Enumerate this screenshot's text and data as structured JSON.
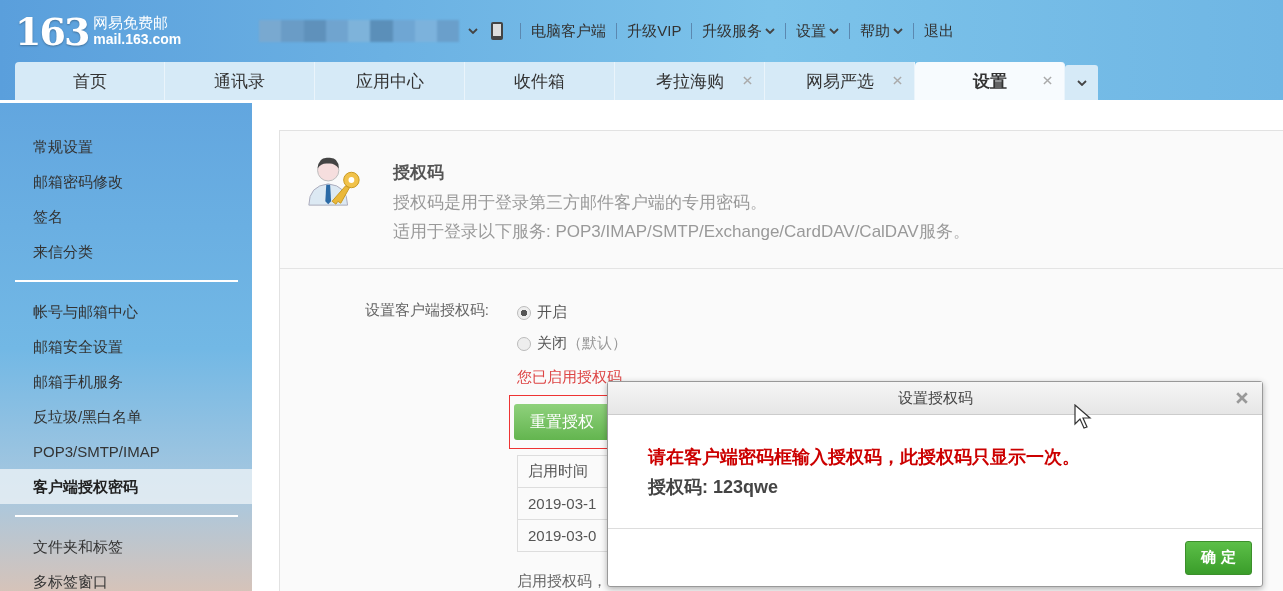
{
  "logo": {
    "number": "163",
    "name": "网易免费邮",
    "domain": "mail.163.com"
  },
  "top_links": [
    {
      "label": "电脑客户端",
      "dropdown": false
    },
    {
      "label": "升级VIP",
      "dropdown": false
    },
    {
      "label": "升级服务",
      "dropdown": true
    },
    {
      "label": "设置",
      "dropdown": true
    },
    {
      "label": "帮助",
      "dropdown": true
    },
    {
      "label": "退出",
      "dropdown": false
    }
  ],
  "tabs": [
    {
      "label": "首页",
      "closable": false,
      "selected": false
    },
    {
      "label": "通讯录",
      "closable": false,
      "selected": false
    },
    {
      "label": "应用中心",
      "closable": false,
      "selected": false
    },
    {
      "label": "收件箱",
      "closable": false,
      "selected": false
    },
    {
      "label": "考拉海购",
      "closable": true,
      "selected": false
    },
    {
      "label": "网易严选",
      "closable": true,
      "selected": false
    },
    {
      "label": "设置",
      "closable": true,
      "selected": true
    }
  ],
  "sidebar": {
    "groups": [
      {
        "items": [
          {
            "label": "常规设置",
            "selected": false
          },
          {
            "label": "邮箱密码修改",
            "selected": false
          },
          {
            "label": "签名",
            "selected": false
          },
          {
            "label": "来信分类",
            "selected": false
          }
        ]
      },
      {
        "items": [
          {
            "label": "帐号与邮箱中心",
            "selected": false
          },
          {
            "label": "邮箱安全设置",
            "selected": false
          },
          {
            "label": "邮箱手机服务",
            "selected": false
          },
          {
            "label": "反垃圾/黑白名单",
            "selected": false
          },
          {
            "label": "POP3/SMTP/IMAP",
            "selected": false
          },
          {
            "label": "客户端授权密码",
            "selected": true
          }
        ]
      },
      {
        "items": [
          {
            "label": "文件夹和标签",
            "selected": false
          },
          {
            "label": "多标签窗口",
            "selected": false
          }
        ]
      }
    ]
  },
  "panel": {
    "title": "授权码",
    "description": [
      "授权码是用于登录第三方邮件客户端的专用密码。",
      "适用于登录以下服务: POP3/IMAP/SMTP/Exchange/CardDAV/CalDAV服务。"
    ],
    "setting_label": "设置客户端授权码:",
    "options": [
      {
        "label": "开启",
        "selected": true
      },
      {
        "label": "关闭",
        "note": "（默认）",
        "selected": false
      }
    ],
    "notice": "您已启用授权码",
    "reset_button": "重置授权",
    "table": {
      "columns": [
        "启用时间"
      ],
      "rows": [
        [
          "2019-03-1"
        ],
        [
          "2019-03-0"
        ]
      ]
    },
    "footer_text": "启用授权码，"
  },
  "dialog": {
    "title": "设置授权码",
    "message": "请在客户端密码框输入授权码，此授权码只显示一次。",
    "code_label": "授权码: 123qwe",
    "button": "确 定"
  }
}
